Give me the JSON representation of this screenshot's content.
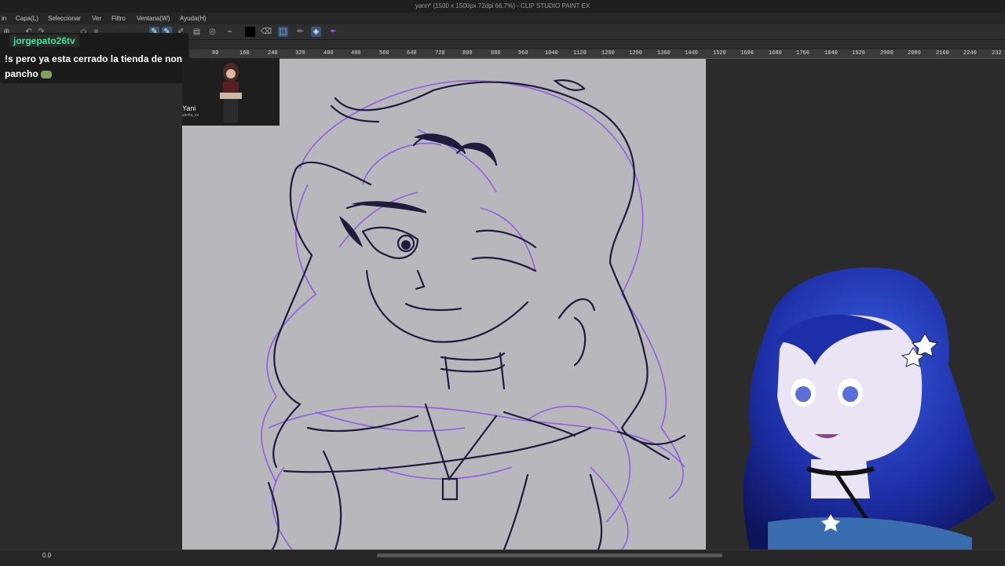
{
  "window": {
    "title": "yann* (1500 x 1500px 72dpi 66.7%) - CLIP STUDIO PAINT EX"
  },
  "menu": [
    "in",
    "Capa(L)",
    "Seleccionar",
    "Ver",
    "Filtro",
    "Ventana(W)",
    "Ayuda(H)"
  ],
  "ruler_ticks": [
    "80",
    "160",
    "240",
    "320",
    "400",
    "480",
    "560",
    "640",
    "720",
    "800",
    "880",
    "960",
    "1040",
    "1120",
    "1200",
    "1280",
    "1360",
    "1440",
    "1520",
    "1600",
    "1680",
    "1760",
    "1840",
    "1920",
    "2000",
    "2080",
    "2160",
    "2240",
    "232"
  ],
  "chat": {
    "username": "jorgepato26tv",
    "message": "!s pero ya esta cerrado la tienda de non pancho"
  },
  "reference": {
    "name": "Yani",
    "subtitle": "yanita_vv"
  },
  "status": {
    "zoom": "0.0"
  },
  "colors": {
    "accent": "#3fe0a2",
    "stroke_dark": "#1f1b3d",
    "stroke_purple": "#8a55e6"
  }
}
